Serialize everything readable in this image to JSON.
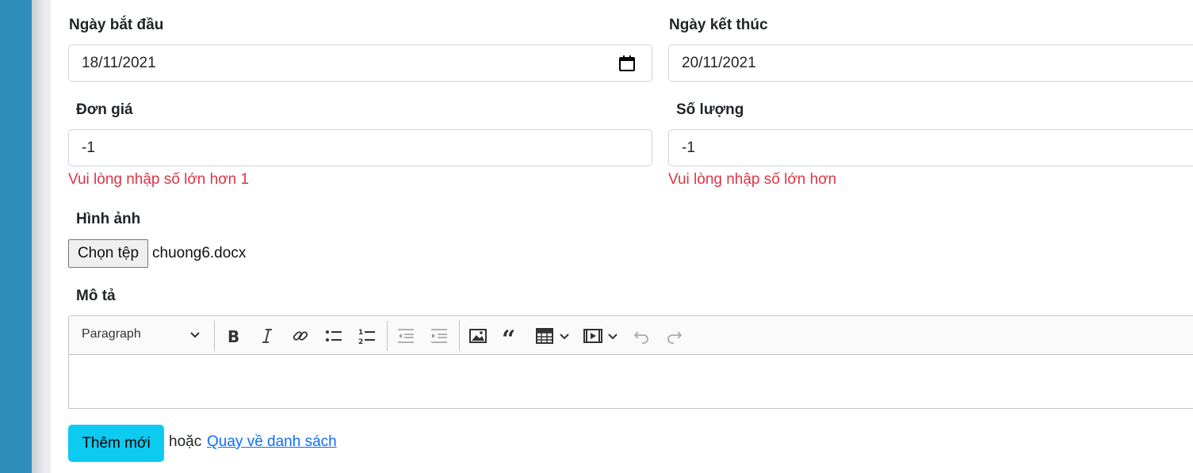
{
  "form": {
    "start_date": {
      "label": "Ngày bắt đầu",
      "value": "18/11/2021"
    },
    "end_date": {
      "label": "Ngày kết thúc",
      "value": "20/11/2021"
    },
    "price": {
      "label": "Đơn giá",
      "value": "-1",
      "error": "Vui lòng nhập số lớn hơn 1"
    },
    "quantity": {
      "label": "Số lượng",
      "value": "-1",
      "error": "Vui lòng nhập số lớn hơn"
    },
    "image": {
      "label": "Hình ảnh",
      "button": "Chọn tệp",
      "file_name": "chuong6.docx"
    },
    "description": {
      "label": "Mô tả",
      "heading_select": "Paragraph"
    },
    "submit": "Thêm mới",
    "or_text": "hoặc",
    "back_link": "Quay về danh sách"
  },
  "toolbar_icons": [
    "bold-icon",
    "italic-icon",
    "link-icon",
    "bulleted-list-icon",
    "numbered-list-icon",
    "outdent-icon",
    "indent-icon",
    "image-icon",
    "quote-icon",
    "table-icon",
    "media-icon",
    "undo-icon",
    "redo-icon"
  ],
  "colors": {
    "sidebar": "#2e8db9",
    "error": "#dc3545",
    "submit": "#0dcaf0",
    "link": "#0d6efd"
  }
}
